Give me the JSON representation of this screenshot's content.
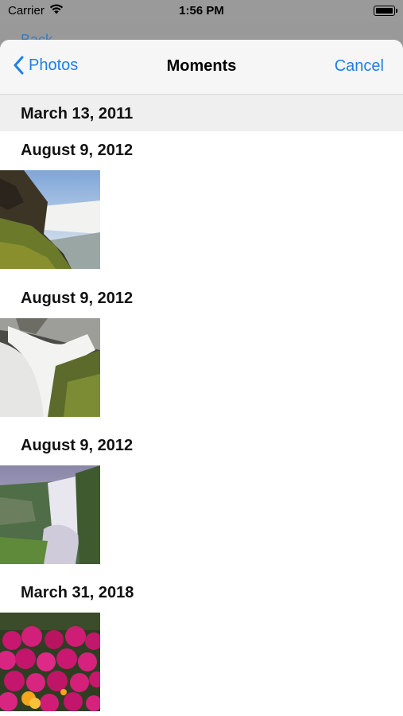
{
  "status_bar": {
    "carrier": "Carrier",
    "time": "1:56 PM"
  },
  "background_nav": {
    "back_label": "Back"
  },
  "navbar": {
    "back_label": "Photos",
    "title": "Moments",
    "cancel_label": "Cancel"
  },
  "sections": [
    {
      "date": "March 13, 2011"
    },
    {
      "date": "August 9, 2012",
      "photo": "waterfall-cliff"
    },
    {
      "date": "August 9, 2012",
      "photo": "waterfall-mossy"
    },
    {
      "date": "August 9, 2012",
      "photo": "waterfall-skogafoss"
    },
    {
      "date": "March 31, 2018",
      "photo": "pink-flowers"
    }
  ],
  "colors": {
    "accent": "#1f7fe6",
    "navbar_bg": "#f6f6f6",
    "section_bg": "#f0efef"
  }
}
